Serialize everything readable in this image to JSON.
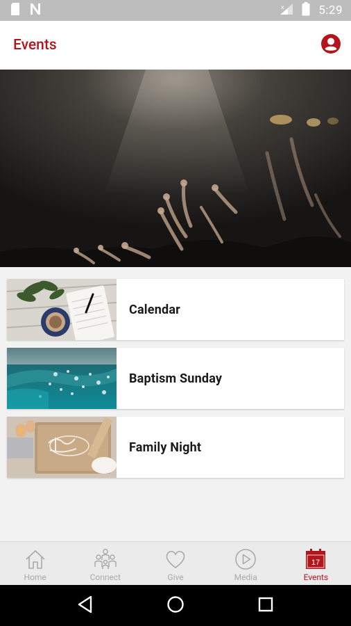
{
  "status_bar": {
    "time": "5:29",
    "icons": [
      "sd-card-icon",
      "n-notification-icon",
      "signal-icon",
      "battery-icon"
    ]
  },
  "header": {
    "title": "Events",
    "profile_icon": "account-circle-icon"
  },
  "colors": {
    "brand_red": "#b0161b",
    "nav_inactive": "#a9a9a9",
    "status_bar": "#bdbdbd"
  },
  "hero": {
    "image": "concert-crowd-hands-raised"
  },
  "events": [
    {
      "label": "Calendar",
      "thumbnail": "notebook-coffee-plant"
    },
    {
      "label": "Baptism Sunday",
      "thumbnail": "water-waves"
    },
    {
      "label": "Family Night",
      "thumbnail": "baking-flour-eggs"
    }
  ],
  "bottom_nav": [
    {
      "label": "Home",
      "icon": "home-icon",
      "active": false
    },
    {
      "label": "Connect",
      "icon": "people-icon",
      "active": false
    },
    {
      "label": "Give",
      "icon": "heart-icon",
      "active": false
    },
    {
      "label": "Media",
      "icon": "play-circle-icon",
      "active": false
    },
    {
      "label": "Events",
      "icon": "calendar-icon",
      "active": true,
      "calendar_number": "17"
    }
  ],
  "system_nav": [
    "back-icon",
    "home-circle-icon",
    "recents-icon"
  ]
}
